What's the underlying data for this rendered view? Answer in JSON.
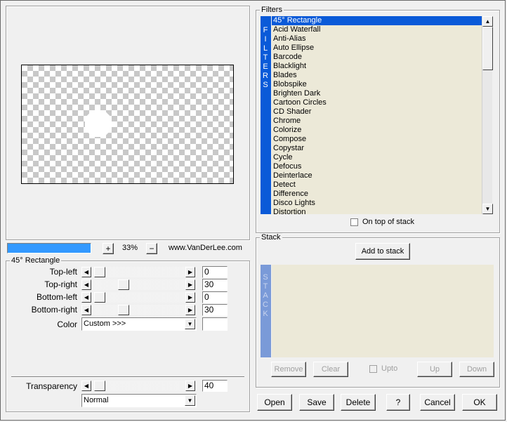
{
  "preview": {
    "zoom_label": "33%",
    "zoom_in": "+",
    "zoom_out": "−",
    "website": "www.VanDerLee.com"
  },
  "filter_group": {
    "title": "45° Rectangle",
    "params": [
      {
        "label": "Top-left",
        "value": "0"
      },
      {
        "label": "Top-right",
        "value": "30"
      },
      {
        "label": "Bottom-left",
        "value": "0"
      },
      {
        "label": "Bottom-right",
        "value": "30"
      }
    ],
    "color_label": "Color",
    "color_value": "Custom >>>",
    "transparency_label": "Transparency",
    "transparency_value": "40",
    "blend_mode": "Normal"
  },
  "filters": {
    "title": "Filters",
    "side_letters": [
      "F",
      "I",
      "L",
      "T",
      "E",
      "R",
      "S"
    ],
    "items": [
      "45° Rectangle",
      "Acid Waterfall",
      "Anti-Alias",
      "Auto Ellipse",
      "Barcode",
      "Blacklight",
      "Blades",
      "Blobspike",
      "Brighten Dark",
      "Cartoon Circles",
      "CD Shader",
      "Chrome",
      "Colorize",
      "Compose",
      "Copystar",
      "Cycle",
      "Defocus",
      "Deinterlace",
      "Detect",
      "Difference",
      "Disco Lights",
      "Distortion"
    ],
    "on_top_label": "On top of stack"
  },
  "stack": {
    "title": "Stack",
    "add_label": "Add to stack",
    "side_letters": [
      "S",
      "T",
      "A",
      "C",
      "K"
    ],
    "remove_label": "Remove",
    "clear_label": "Clear",
    "upto_label": "Upto",
    "up_label": "Up",
    "down_label": "Down"
  },
  "footer": {
    "open": "Open",
    "save": "Save",
    "delete": "Delete",
    "help": "?",
    "cancel": "Cancel",
    "ok": "OK"
  },
  "colors": {
    "accent": "#0a5ad8",
    "progress": "#3399ff",
    "stack_side": "#7a9ad8",
    "list_bg": "#ece9d8"
  }
}
